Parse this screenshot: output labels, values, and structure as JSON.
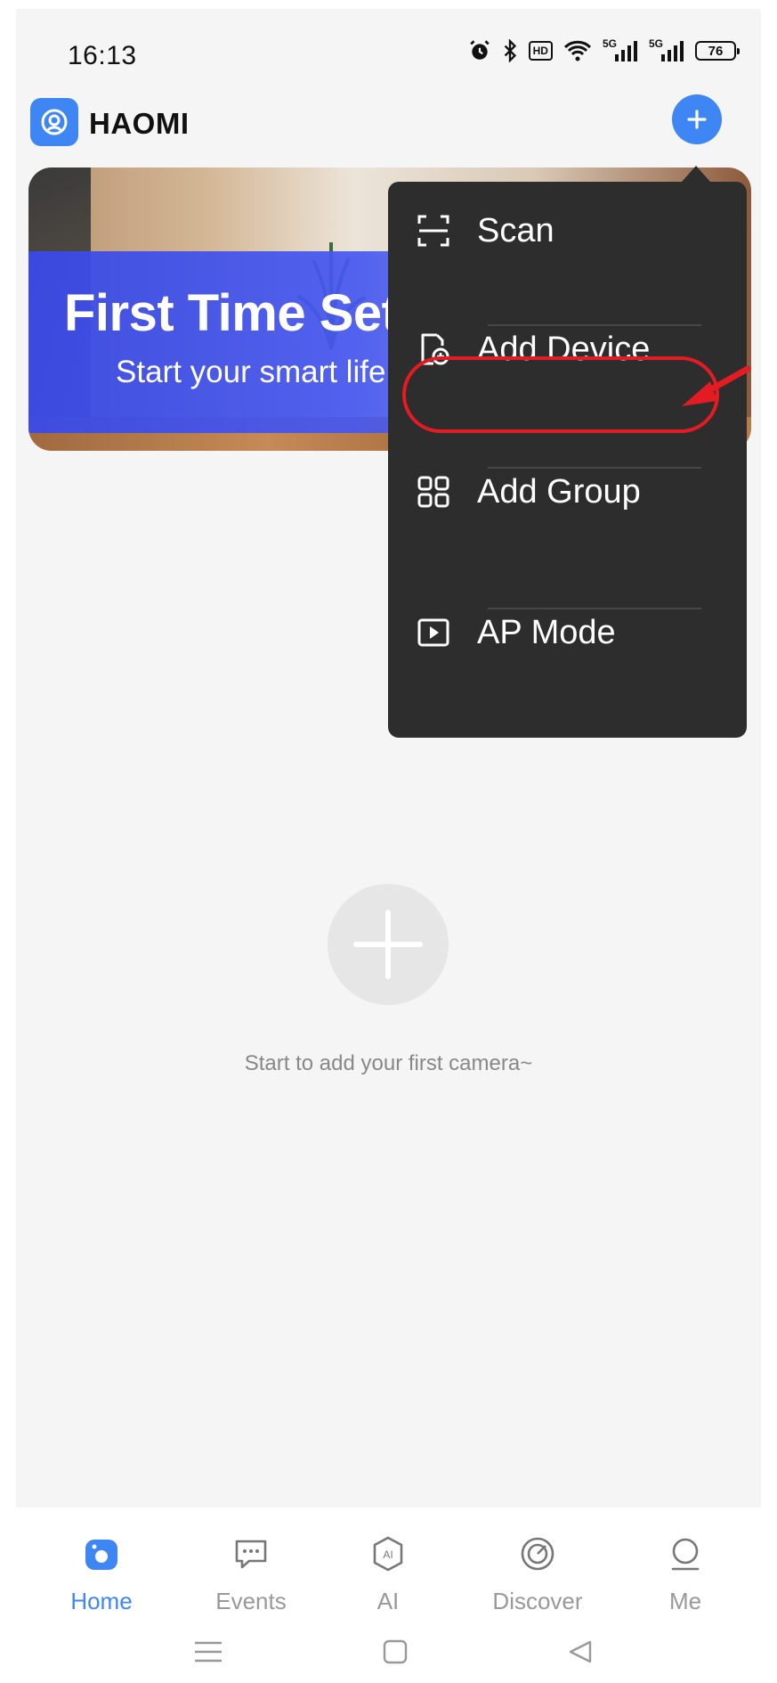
{
  "status_bar": {
    "time": "16:13",
    "hd_label": "HD",
    "signal_label": "5G",
    "battery": "76"
  },
  "header": {
    "app_name": "HAOMI",
    "add_icon": "plus-icon"
  },
  "banner": {
    "title": "First Time Setup",
    "subtitle": "Start your smart life"
  },
  "menu": {
    "items": [
      {
        "label": "Scan",
        "icon": "scan-icon"
      },
      {
        "label": "Add Device",
        "icon": "add-device-icon"
      },
      {
        "label": "Add Group",
        "icon": "grid-icon"
      },
      {
        "label": "AP Mode",
        "icon": "play-box-icon"
      }
    ],
    "highlight_color": "#e31b23"
  },
  "empty_state": {
    "message": "Start to add your first camera~"
  },
  "bottom_nav": {
    "items": [
      {
        "label": "Home",
        "icon": "home-icon",
        "active": true
      },
      {
        "label": "Events",
        "icon": "message-icon",
        "active": false
      },
      {
        "label": "AI",
        "icon": "ai-icon",
        "active": false
      },
      {
        "label": "Discover",
        "icon": "discover-icon",
        "active": false
      },
      {
        "label": "Me",
        "icon": "user-icon",
        "active": false
      }
    ]
  },
  "colors": {
    "accent": "#3f86f5",
    "menu_bg": "#2d2d2d",
    "banner_blue": "#3a4ae6"
  }
}
